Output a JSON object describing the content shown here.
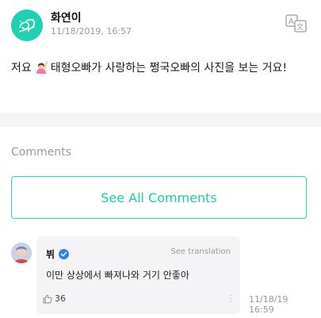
{
  "post": {
    "author": "화연이",
    "timestamp": "11/18/2019, 16:57",
    "text_before_emoji": "저요",
    "emoji": "person-raising-hand",
    "text_after_emoji": "태형오빠가 사랑하는 쩡국오빠의 사진을 보는 거요!",
    "translate_icon": "translate-icon"
  },
  "comments_section": {
    "label": "Comments",
    "see_all_label": "See All Comments"
  },
  "comment": {
    "author": "뷔",
    "verified": true,
    "see_translation": "See translation",
    "text": "이만 상상에서 빠져나와 거기 안좋아",
    "likes": "36",
    "timestamp_date": "11/18/19",
    "timestamp_time": "16:59"
  },
  "colors": {
    "accent": "#1ccbb0",
    "avatar_bg": "#1fd0b3",
    "verified": "#2f80ed"
  }
}
